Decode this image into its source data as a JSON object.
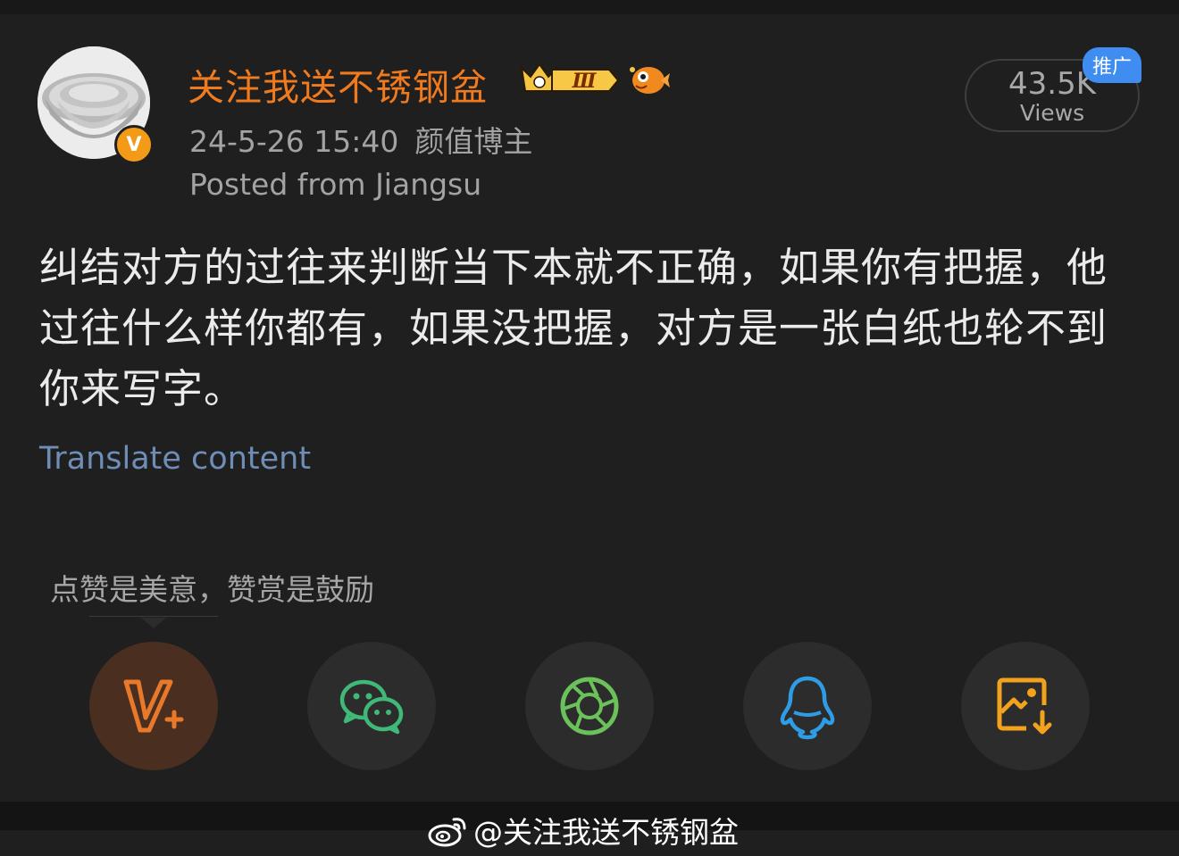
{
  "author": {
    "name": "关注我送不锈钢盆",
    "verified_mark": "V",
    "level_badge": "Ⅲ"
  },
  "post": {
    "timestamp": "24-5-26 15:40",
    "category_tag": "颜值博主",
    "location": "Posted from Jiangsu",
    "text": "纠结对方的过往来判断当下本就不正确，如果你有把握，他过往什么样你都有，如果没把握，对方是一张白纸也轮不到你来写字。",
    "translate_label": "Translate content"
  },
  "stats": {
    "views_count": "43.5K",
    "views_label": "Views",
    "promo_label": "推广"
  },
  "reward": {
    "hint": "点赞是美意，赞赏是鼓励"
  },
  "share": {
    "buttons": [
      {
        "icon": "v-plus-reward-icon",
        "color": "#e8782a"
      },
      {
        "icon": "wechat-icon",
        "color": "#3fb878"
      },
      {
        "icon": "moments-aperture-icon",
        "color": "#6bc15a"
      },
      {
        "icon": "qq-penguin-icon",
        "color": "#2e9de6"
      },
      {
        "icon": "save-image-icon",
        "color": "#f2a21c"
      }
    ]
  },
  "watermark": {
    "text": "@关注我送不锈钢盆"
  },
  "colors": {
    "background": "#1f1f1f",
    "username": "#f07a1e",
    "link": "#6e8eb8",
    "promo": "#3f8df0"
  }
}
